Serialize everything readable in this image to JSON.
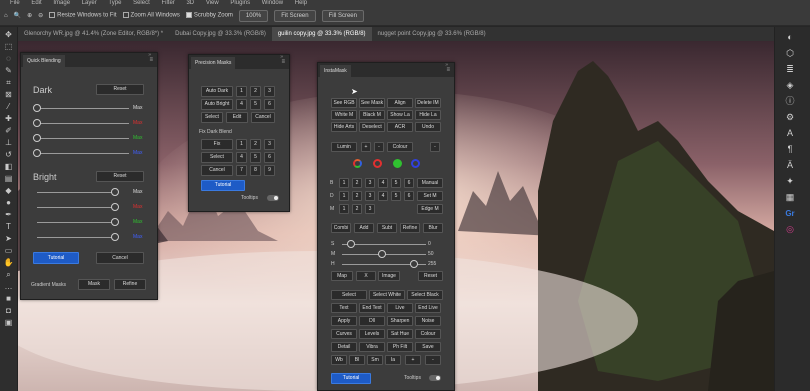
{
  "menubar": {
    "items": [
      "File",
      "Edit",
      "Image",
      "Layer",
      "Type",
      "Select",
      "Filter",
      "3D",
      "View",
      "Plugins",
      "Window",
      "Help"
    ]
  },
  "options": {
    "resize_windows": "Resize Windows to Fit",
    "zoom_all": "Zoom All Windows",
    "scrubby_zoom": "Scrubby Zoom",
    "zoom_value": "100%",
    "fit_screen": "Fit Screen",
    "fill_screen": "Fill Screen"
  },
  "doc_tabs": [
    "Glenorchy WR.jpg @ 41.4% (Zone Editor, RGB/8*) *",
    "Dubai  Copy.jpg @ 33.3% (RGB/8)",
    "guilin copy.jpg @ 33.3% (RGB/8)",
    "nugget point  Copy.jpg @ 33.6% (RGB/8)"
  ],
  "quick_blending": {
    "title": "Quick Blending",
    "dark_label": "Dark",
    "bright_label": "Bright",
    "reset": "Reset",
    "max": "Max",
    "tutorial": "Tutorial",
    "cancel": "Cancel",
    "gradient_masks": "Gradient Masks",
    "mask": "Mask",
    "refine": "Refine"
  },
  "precision_masks": {
    "title": "Precision Masks",
    "auto_dark": "Auto Dark",
    "auto_bright": "Auto Bright",
    "select": "Select",
    "edit": "Edit",
    "cancel": "Cancel",
    "fix_dark_blend": "Fix Dark Blend",
    "fix": "Fix",
    "nums": [
      "1",
      "2",
      "3",
      "4",
      "5",
      "6",
      "7",
      "8",
      "9"
    ],
    "tutorial": "Tutorial",
    "tooltips": "Tooltips"
  },
  "instamask": {
    "title": "InstaMask",
    "r1": [
      "See RGB",
      "See Mask",
      "Align",
      "Delete IM"
    ],
    "r2": [
      "White M",
      "Black M",
      "Show La",
      "Hide La"
    ],
    "r3": [
      "Hide Arts",
      "Deselect",
      "ACR",
      "Undo"
    ],
    "lumin": "Lumin",
    "colour": "Colour",
    "plus": "+",
    "minus": "-",
    "row_b": "B",
    "row_d": "D",
    "row_m": "M",
    "nums": [
      "1",
      "2",
      "3",
      "4",
      "5",
      "6"
    ],
    "manual": "Manual",
    "set_m": "Set M",
    "edge_m": "Edge M",
    "ops": [
      "Combi",
      "Add",
      "Subt",
      "Refine",
      "Blur"
    ],
    "s_label": "S",
    "m_label": "M",
    "h_label": "H",
    "s_val": "0",
    "m_val": "50",
    "h_val": "255",
    "map": "Map",
    "x": "X",
    "image": "Image",
    "reset": "Reset",
    "sel_row": [
      "Select",
      "Select White",
      "Select Black"
    ],
    "g1": [
      "Text",
      "End Text",
      "Live",
      "End Live"
    ],
    "g2": [
      "Apply",
      "Dll",
      "Sharpen",
      "Noise"
    ],
    "g3": [
      "Curves",
      "Levels",
      "Sat Hue",
      "Colour"
    ],
    "g4": [
      "Detail",
      "Vibra",
      "Ph Filt",
      "Save"
    ],
    "last": [
      "Wb",
      "Bl",
      "Sm",
      "Ia",
      "+",
      "-"
    ],
    "tutorial": "Tutorial",
    "tooltips": "Tooltips"
  },
  "colors": {
    "accent_blue": "#1e5bc6",
    "panel_bg": "#3c3c3c"
  }
}
